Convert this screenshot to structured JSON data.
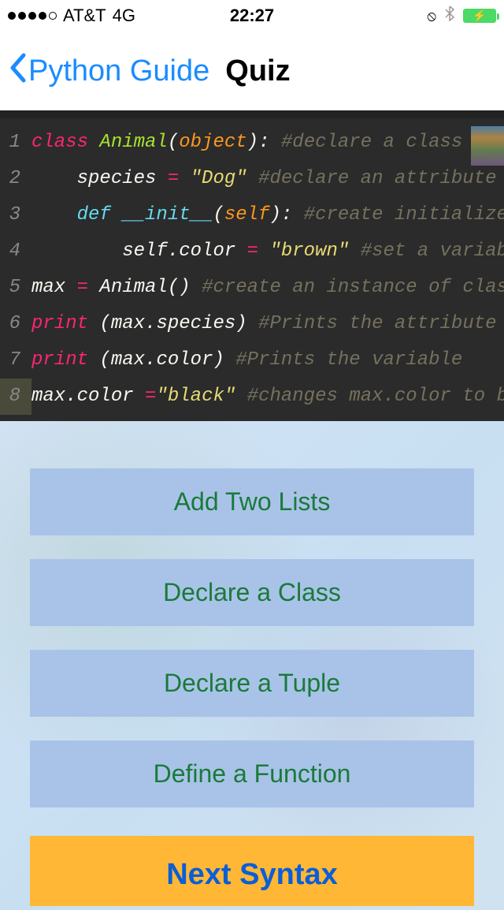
{
  "status": {
    "carrier": "AT&T",
    "network": "4G",
    "time": "22:27"
  },
  "nav": {
    "back_label": "Python Guide",
    "title": "Quiz"
  },
  "code": {
    "lines": [
      {
        "n": "1",
        "parts": [
          [
            "kw-class",
            "class "
          ],
          [
            "cls-name",
            "Animal"
          ],
          [
            "punct",
            "("
          ],
          [
            "param",
            "object"
          ],
          [
            "punct",
            "): "
          ],
          [
            "comment",
            "#declare a class"
          ]
        ]
      },
      {
        "n": "2",
        "parts": [
          [
            "ident",
            "    species "
          ],
          [
            "eq",
            "= "
          ],
          [
            "string",
            "\"Dog\" "
          ],
          [
            "comment",
            "#declare an attribute"
          ]
        ]
      },
      {
        "n": "3",
        "parts": [
          [
            "kw-def",
            "    def "
          ],
          [
            "fn-name",
            "__init__"
          ],
          [
            "punct",
            "("
          ],
          [
            "param",
            "self"
          ],
          [
            "punct",
            "): "
          ],
          [
            "comment",
            "#create initializer"
          ]
        ]
      },
      {
        "n": "4",
        "parts": [
          [
            "ident",
            "        self"
          ],
          [
            "punct",
            "."
          ],
          [
            "ident",
            "color "
          ],
          [
            "eq",
            "= "
          ],
          [
            "string",
            "\"brown\" "
          ],
          [
            "comment",
            "#set a variable"
          ]
        ]
      },
      {
        "n": "5",
        "parts": [
          [
            "ident",
            "max "
          ],
          [
            "eq",
            "= "
          ],
          [
            "ident",
            "Animal"
          ],
          [
            "punct",
            "() "
          ],
          [
            "comment",
            "#create an instance of class Animal"
          ]
        ]
      },
      {
        "n": "6",
        "parts": [
          [
            "kw-print",
            "print "
          ],
          [
            "punct",
            "("
          ],
          [
            "ident",
            "max"
          ],
          [
            "punct",
            "."
          ],
          [
            "ident",
            "species"
          ],
          [
            "punct",
            ") "
          ],
          [
            "comment",
            "#Prints the attribute"
          ]
        ]
      },
      {
        "n": "7",
        "parts": [
          [
            "kw-print",
            "print "
          ],
          [
            "punct",
            "("
          ],
          [
            "ident",
            "max"
          ],
          [
            "punct",
            "."
          ],
          [
            "ident",
            "color"
          ],
          [
            "punct",
            ") "
          ],
          [
            "comment",
            "#Prints the variable"
          ]
        ]
      },
      {
        "n": "8",
        "parts": [
          [
            "ident",
            "max"
          ],
          [
            "punct",
            "."
          ],
          [
            "ident",
            "color "
          ],
          [
            "eq",
            "="
          ],
          [
            "string",
            "\"black\" "
          ],
          [
            "comment",
            "#changes max.color to black"
          ]
        ],
        "hl": true
      }
    ]
  },
  "quiz": {
    "answers": [
      "Add Two Lists",
      "Declare a Class",
      "Declare a Tuple",
      "Define a Function"
    ],
    "next_label": "Next Syntax"
  }
}
